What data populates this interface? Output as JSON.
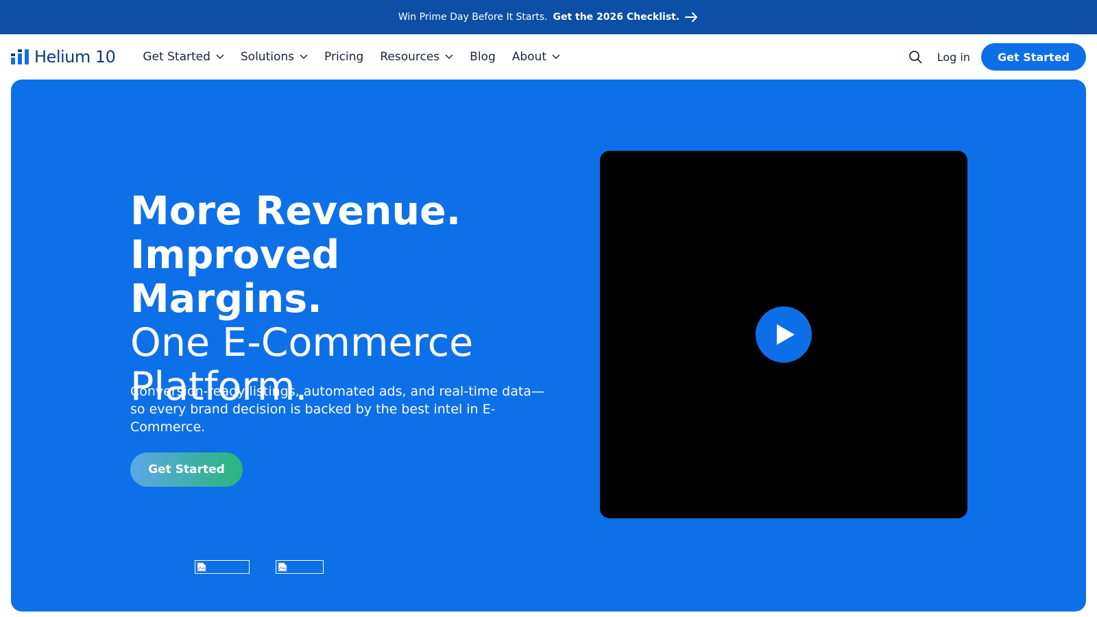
{
  "announcement": {
    "lead": "Win Prime Day Before It Starts.",
    "cta": "Get the 2026 Checklist."
  },
  "nav": {
    "logo_text": "Helium 10",
    "items": [
      {
        "label": "Get Started",
        "dropdown": true
      },
      {
        "label": "Solutions",
        "dropdown": true
      },
      {
        "label": "Pricing",
        "dropdown": false
      },
      {
        "label": "Resources",
        "dropdown": true
      },
      {
        "label": "Blog",
        "dropdown": false
      },
      {
        "label": "About",
        "dropdown": true
      }
    ],
    "login_label": "Log in",
    "cta_label": "Get Started",
    "icons": {
      "search": "search-icon",
      "chevron": "chevron-down-icon"
    }
  },
  "hero": {
    "headline_bold_1": "More Revenue.",
    "headline_bold_2": "Improved Margins.",
    "headline_light_1": "One E-Commerce",
    "headline_light_2": "Platform.",
    "subtext": "Conversion-ready listings, automated ads, and real-time data—so every brand decision is backed by the best intel in E-Commerce.",
    "cta_label": "Get Started",
    "video_icon": "play-icon"
  },
  "colors": {
    "announce_bg": "#0d4fa6",
    "hero_bg": "#0d70e8",
    "primary": "#0d6fe8",
    "brand_text": "#0e3a78",
    "gradient_start": "#5aa8e6",
    "gradient_end": "#2bb57a"
  }
}
